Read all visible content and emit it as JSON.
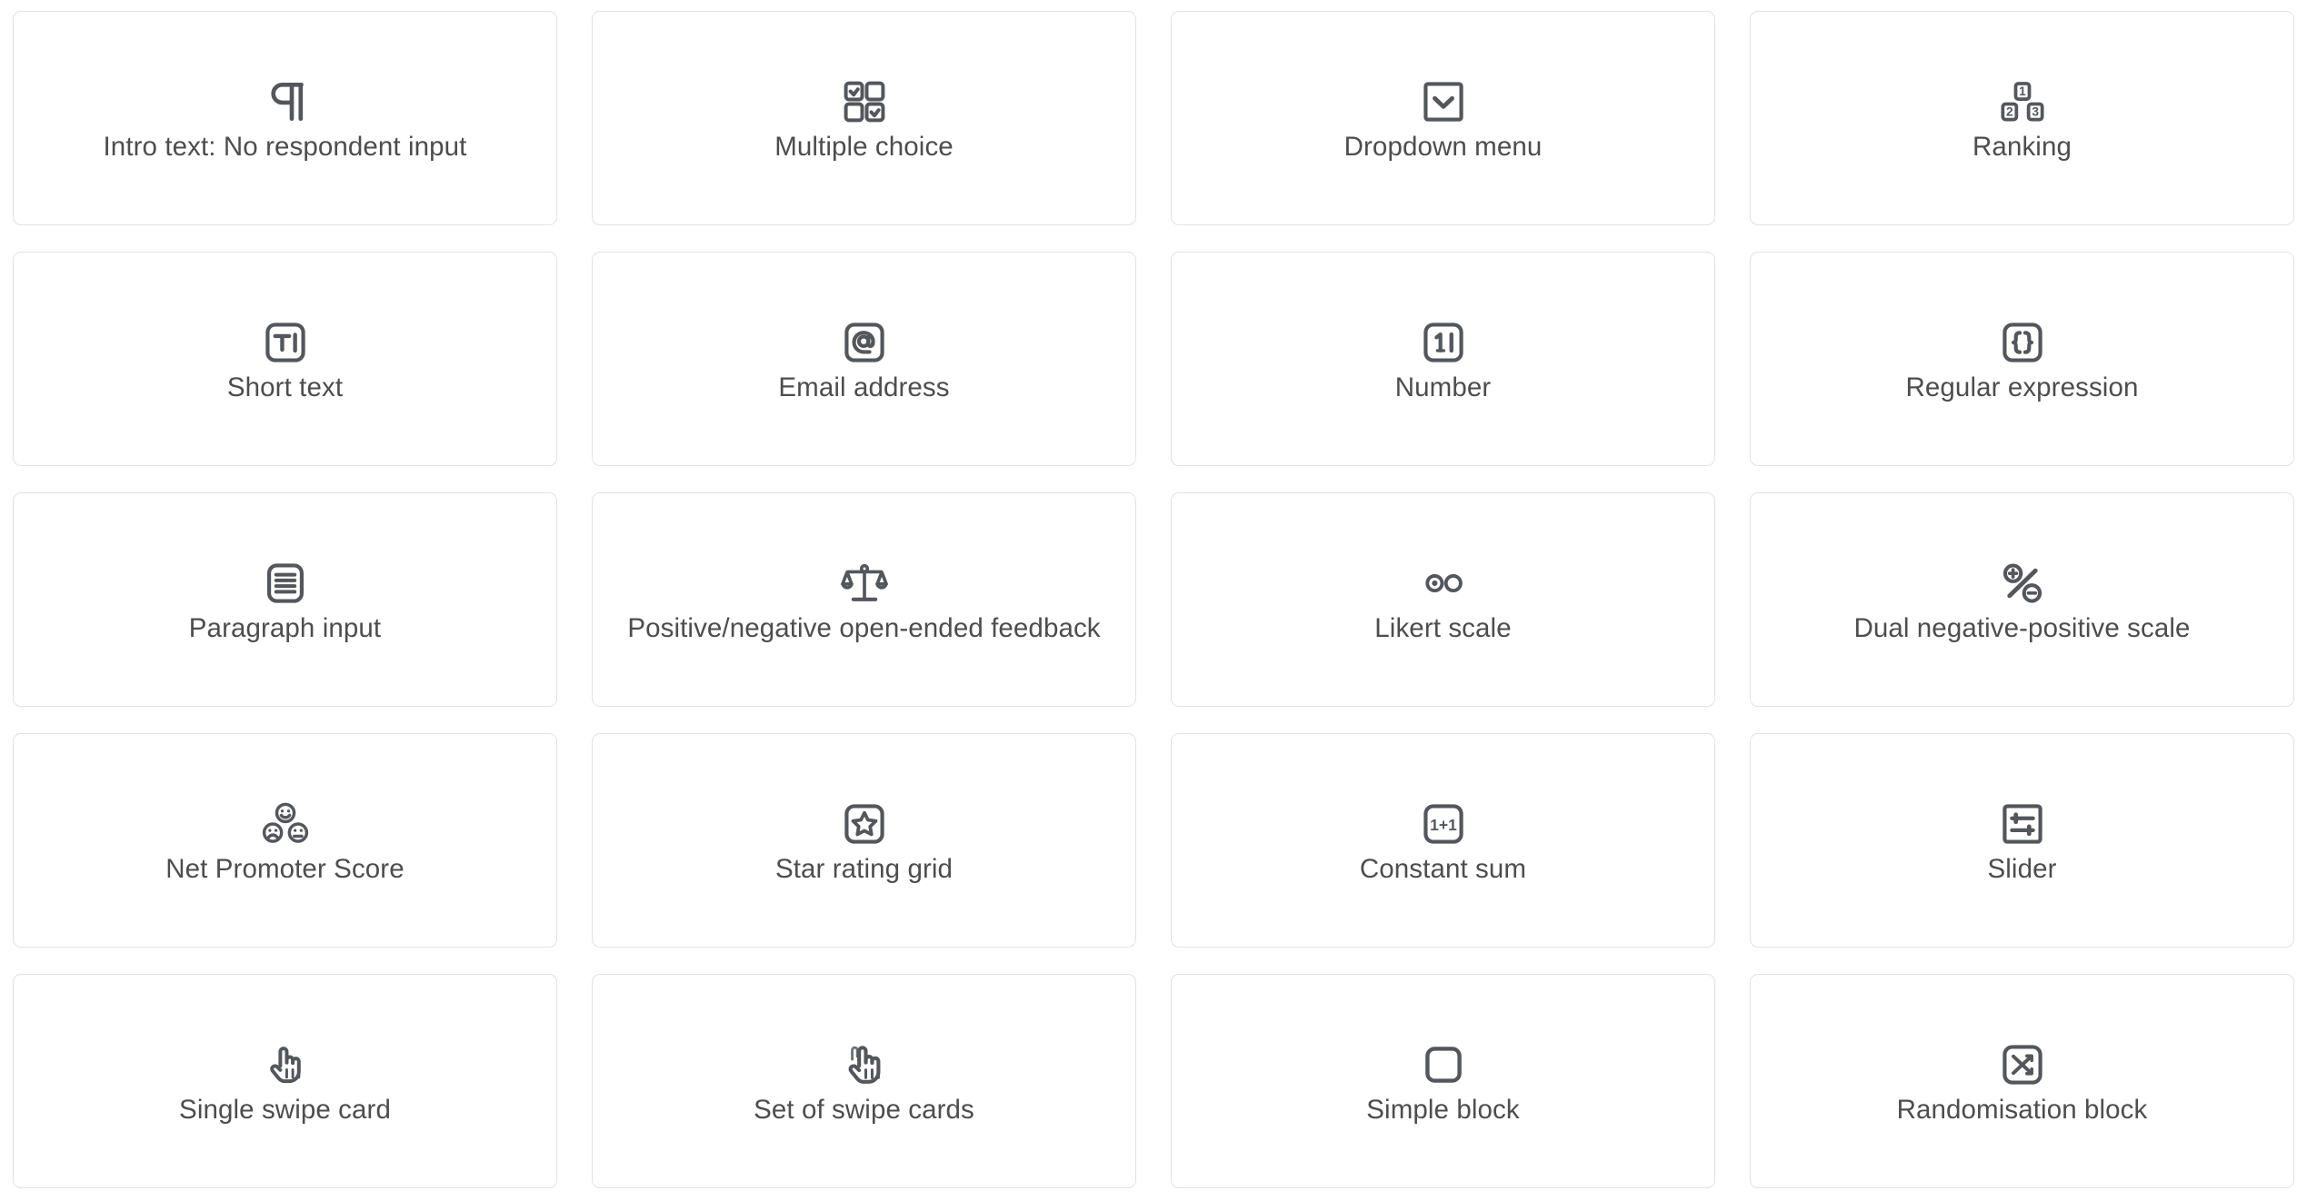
{
  "palette": {
    "card_border": "#e2e2e2",
    "card_background": "#ffffff",
    "icon_color": "#53575c",
    "label_color": "#4d4d4d",
    "page_background": "#ffffff"
  },
  "grid": {
    "columns": 4,
    "rows": 5,
    "cards": [
      {
        "label": "Intro text: No respondent input",
        "icon": "pilcrow-icon"
      },
      {
        "label": "Multiple choice",
        "icon": "checkbox-grid-icon"
      },
      {
        "label": "Dropdown menu",
        "icon": "chevron-down-box-icon"
      },
      {
        "label": "Ranking",
        "icon": "numbered-blocks-icon",
        "icon_text": [
          "1",
          "2",
          "3"
        ]
      },
      {
        "label": "Short text",
        "icon": "text-cursor-box-icon",
        "icon_text": [
          "T"
        ]
      },
      {
        "label": "Email address",
        "icon": "at-sign-box-icon",
        "icon_text": [
          "@"
        ]
      },
      {
        "label": "Number",
        "icon": "number-cursor-box-icon",
        "icon_text": [
          "1"
        ]
      },
      {
        "label": "Regular expression",
        "icon": "curly-braces-box-icon",
        "icon_text": [
          "{}"
        ]
      },
      {
        "label": "Paragraph input",
        "icon": "text-lines-box-icon"
      },
      {
        "label": "Positive/negative open-ended feedback",
        "icon": "balance-scales-icon"
      },
      {
        "label": "Likert scale",
        "icon": "radio-buttons-icon"
      },
      {
        "label": "Dual negative-positive scale",
        "icon": "plus-minus-percent-icon"
      },
      {
        "label": "Net Promoter Score",
        "icon": "emoji-faces-icon"
      },
      {
        "label": "Star rating grid",
        "icon": "star-box-icon"
      },
      {
        "label": "Constant sum",
        "icon": "one-plus-one-box-icon",
        "icon_text": [
          "1+1"
        ]
      },
      {
        "label": "Slider",
        "icon": "sliders-box-icon"
      },
      {
        "label": "Single swipe card",
        "icon": "pointing-hand-icon"
      },
      {
        "label": "Set of swipe cards",
        "icon": "pointing-hand-stack-icon"
      },
      {
        "label": "Simple block",
        "icon": "empty-rounded-square-icon"
      },
      {
        "label": "Randomisation block",
        "icon": "shuffle-box-icon"
      }
    ]
  }
}
